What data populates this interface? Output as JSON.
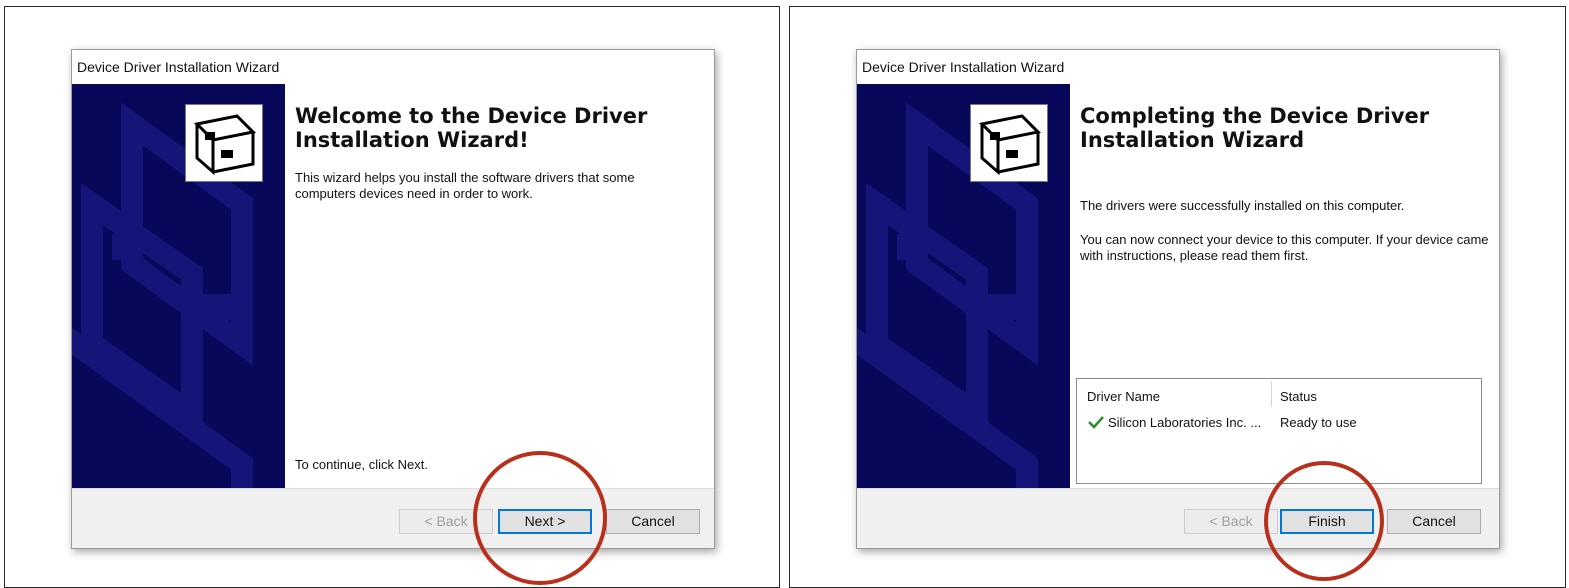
{
  "left_dialog": {
    "title": "Device Driver Installation Wizard",
    "heading": "Welcome to the Device Driver Installation Wizard!",
    "description": "This wizard helps you install the software drivers that some computers devices need in order to work.",
    "continue_text": "To continue, click Next.",
    "buttons": {
      "back": "< Back",
      "next": "Next >",
      "cancel": "Cancel"
    },
    "back_enabled": false,
    "highlighted_button": "next"
  },
  "right_dialog": {
    "title": "Device Driver Installation Wizard",
    "heading": "Completing the Device Driver Installation Wizard",
    "status_text": "The drivers were successfully installed on this computer.",
    "connect_text": "You can now connect your device to this computer. If your device came with instructions, please read them first.",
    "driver_table": {
      "columns": [
        "Driver Name",
        "Status"
      ],
      "rows": [
        {
          "name": "Silicon Laboratories Inc. ...",
          "status": "Ready to use",
          "icon": "checkmark-icon"
        }
      ]
    },
    "buttons": {
      "back": "< Back",
      "finish": "Finish",
      "cancel": "Cancel"
    },
    "back_enabled": false,
    "highlighted_button": "finish"
  },
  "colors": {
    "sidebar": "#08085a",
    "highlight_circle": "#b8301c",
    "focus_border": "#0078d7",
    "check": "#2a8f2a"
  }
}
